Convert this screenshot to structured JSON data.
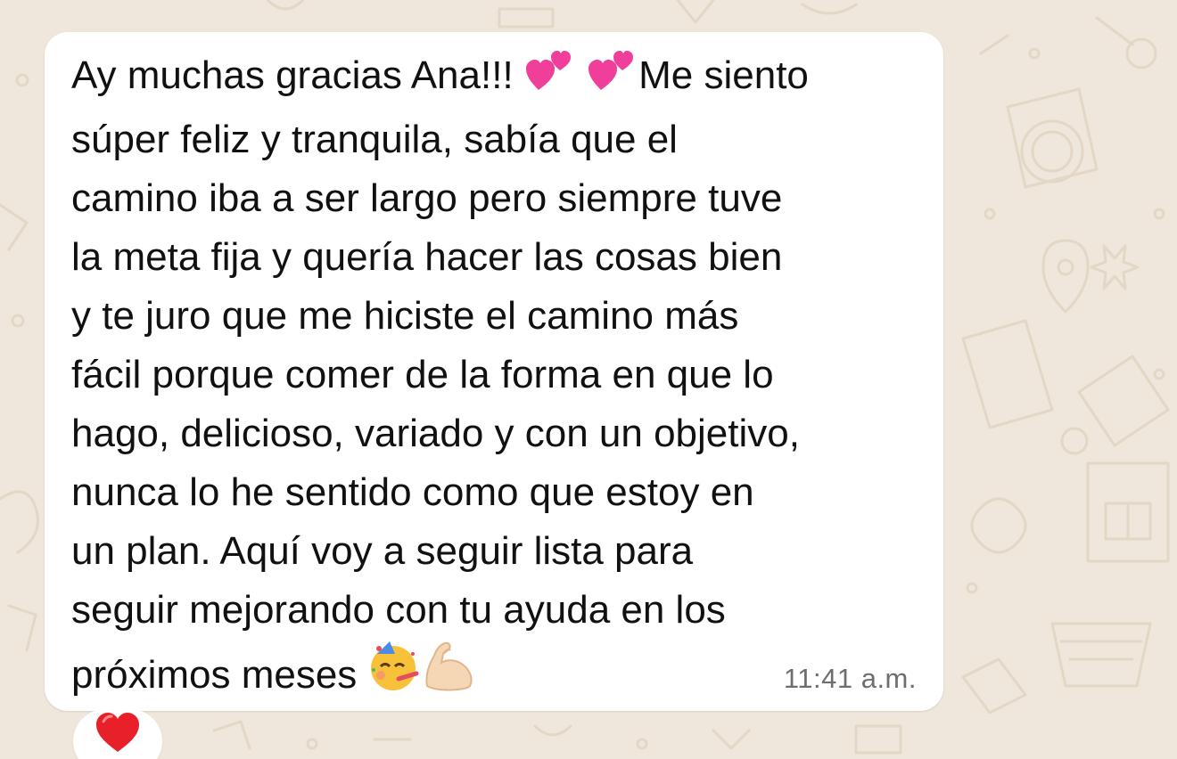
{
  "message": {
    "line1_before_emoji": "Ay muchas gracias Ana!!! ",
    "line1_after_emoji": "Me siento",
    "body": "súper feliz y tranquila, sabía que el\ncamino iba a ser largo pero siempre tuve\nla meta fija y quería hacer las cosas bien\ny te juro que me hiciste el camino más\nfácil porque comer de la forma en que lo\nhago, delicioso, variado y con un objetivo,\nnunca lo he sentido como que estoy en\nun plan. Aquí voy a seguir lista para\nseguir mejorando con tu ayuda en los\n",
    "last_line": "próximos meses ",
    "inline_emojis": [
      "two-hearts-icon",
      "two-hearts-icon",
      "partying-face-icon",
      "flexed-biceps-icon"
    ],
    "timestamp": "11:41 a.m."
  },
  "reaction": {
    "emoji": "red-heart-icon"
  },
  "colors": {
    "wallpaper": "#efe7dc",
    "bubble": "#ffffff",
    "text": "#111111",
    "timestamp": "#6e6e6e",
    "heart_pink": "#f03e9b",
    "heart_red": "#e8202a"
  }
}
